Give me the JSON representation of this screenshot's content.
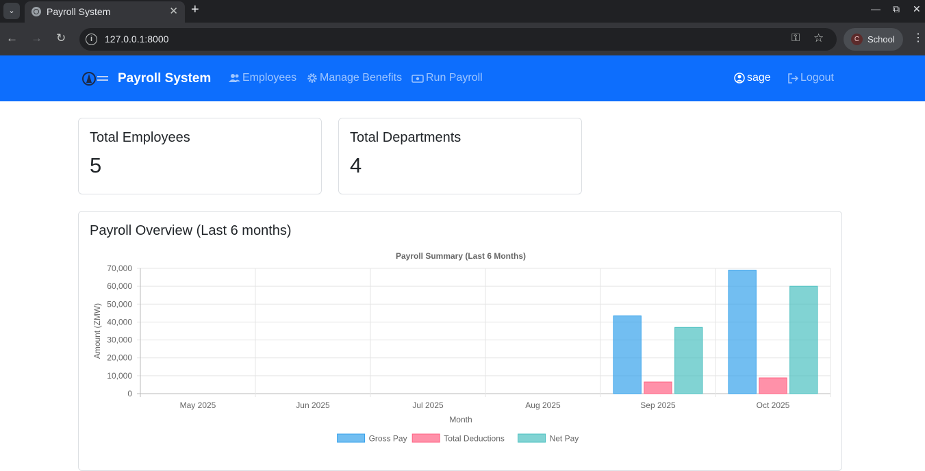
{
  "browser": {
    "tab_title": "Payroll System",
    "url": "127.0.0.1:8000",
    "profile_initial": "C",
    "profile_name": "School"
  },
  "navbar": {
    "brand": "Payroll System",
    "links": [
      {
        "label": "Employees",
        "icon": "users-icon"
      },
      {
        "label": "Manage Benefits",
        "icon": "gear-icon"
      },
      {
        "label": "Run Payroll",
        "icon": "cash-icon"
      }
    ],
    "user": "sage",
    "logout": "Logout"
  },
  "stats": {
    "employees_title": "Total Employees",
    "employees_value": "5",
    "departments_title": "Total Departments",
    "departments_value": "4"
  },
  "overview": {
    "title": "Payroll Overview (Last 6 months)"
  },
  "colors": {
    "primary": "#0d6efd",
    "gross_fill": "rgba(54,162,235,0.7)",
    "gross_stroke": "#36a2eb",
    "deductions_fill": "rgba(255,99,132,0.7)",
    "deductions_stroke": "#ff6384",
    "net_fill": "rgba(75,192,192,0.7)",
    "net_stroke": "#4bc0c0"
  },
  "chart_data": {
    "type": "bar",
    "title": "Payroll Summary (Last 6 Months)",
    "xlabel": "Month",
    "ylabel": "Amount (ZMW)",
    "ylim": [
      0,
      70000
    ],
    "yticks": [
      "0",
      "10,000",
      "20,000",
      "30,000",
      "40,000",
      "50,000",
      "60,000",
      "70,000"
    ],
    "categories": [
      "May 2025",
      "Jun 2025",
      "Jul 2025",
      "Aug 2025",
      "Sep 2025",
      "Oct 2025"
    ],
    "series": [
      {
        "name": "Gross Pay",
        "values": [
          0,
          0,
          0,
          0,
          43500,
          69000
        ]
      },
      {
        "name": "Total Deductions",
        "values": [
          0,
          0,
          0,
          0,
          6500,
          8800
        ]
      },
      {
        "name": "Net Pay",
        "values": [
          0,
          0,
          0,
          0,
          37000,
          60000
        ]
      }
    ],
    "grid": true,
    "legend": "bottom"
  }
}
